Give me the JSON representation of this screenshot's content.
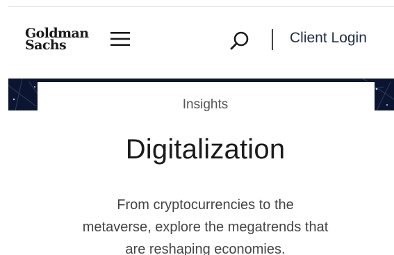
{
  "header": {
    "logo_line1": "Goldman",
    "logo_line2": "Sachs",
    "client_login": "Client Login"
  },
  "icons": {
    "menu": "hamburger-menu-icon",
    "search": "search-icon"
  },
  "hero": {
    "eyebrow": "Insights",
    "title": "Digitalization",
    "description": "From cryptocurrencies to the metaverse, explore the megatrends that are reshaping economies."
  },
  "colors": {
    "hero_background": "#0b1530",
    "link_text": "#1f2a44"
  }
}
